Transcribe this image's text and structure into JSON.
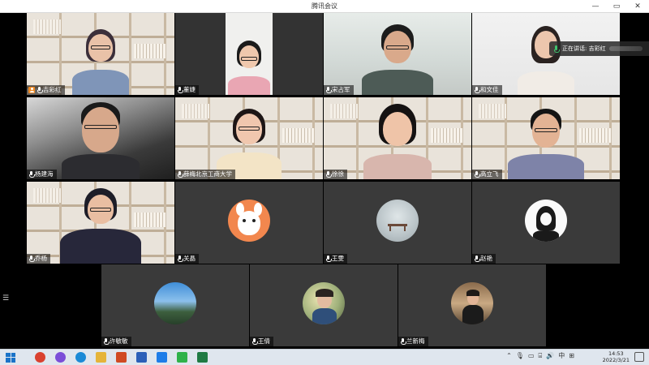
{
  "window": {
    "title": "腾讯会议",
    "minimize": "—",
    "maximize": "▭",
    "close": "✕"
  },
  "speaking_notice": {
    "label": "正在讲话: 吉彩红"
  },
  "participants": [
    {
      "name": "吉彩红",
      "host": true
    },
    {
      "name": "董婕"
    },
    {
      "name": "宋占军"
    },
    {
      "name": "和文佳"
    },
    {
      "name": "杨建海"
    },
    {
      "name": "薛梅北京工商大学"
    },
    {
      "name": "徐徐"
    },
    {
      "name": "高立飞"
    },
    {
      "name": "乔杨"
    },
    {
      "name": "关晶"
    },
    {
      "name": "王雯"
    },
    {
      "name": "赵艳"
    },
    {
      "name": "许敏敏"
    },
    {
      "name": "王倩"
    },
    {
      "name": "兰新梅"
    }
  ],
  "taskbar": {
    "apps": [
      {
        "icon": "chrome-icon",
        "color": "#d9412f"
      },
      {
        "icon": "browser-icon",
        "color": "#7b4ed8"
      },
      {
        "icon": "edge-icon",
        "color": "#1b8ad6"
      },
      {
        "icon": "folder-icon",
        "color": "#e5b43a"
      },
      {
        "icon": "powerpoint-icon",
        "color": "#d04a23"
      },
      {
        "icon": "word-icon",
        "color": "#2b5fb8"
      },
      {
        "icon": "meeting-icon",
        "color": "#1e7de8"
      },
      {
        "icon": "wechat-icon",
        "color": "#2fb24a"
      },
      {
        "icon": "excel-icon",
        "color": "#1f7a43"
      }
    ],
    "tray_lang": "中",
    "time": "14:53",
    "date": "2022/3/21"
  }
}
